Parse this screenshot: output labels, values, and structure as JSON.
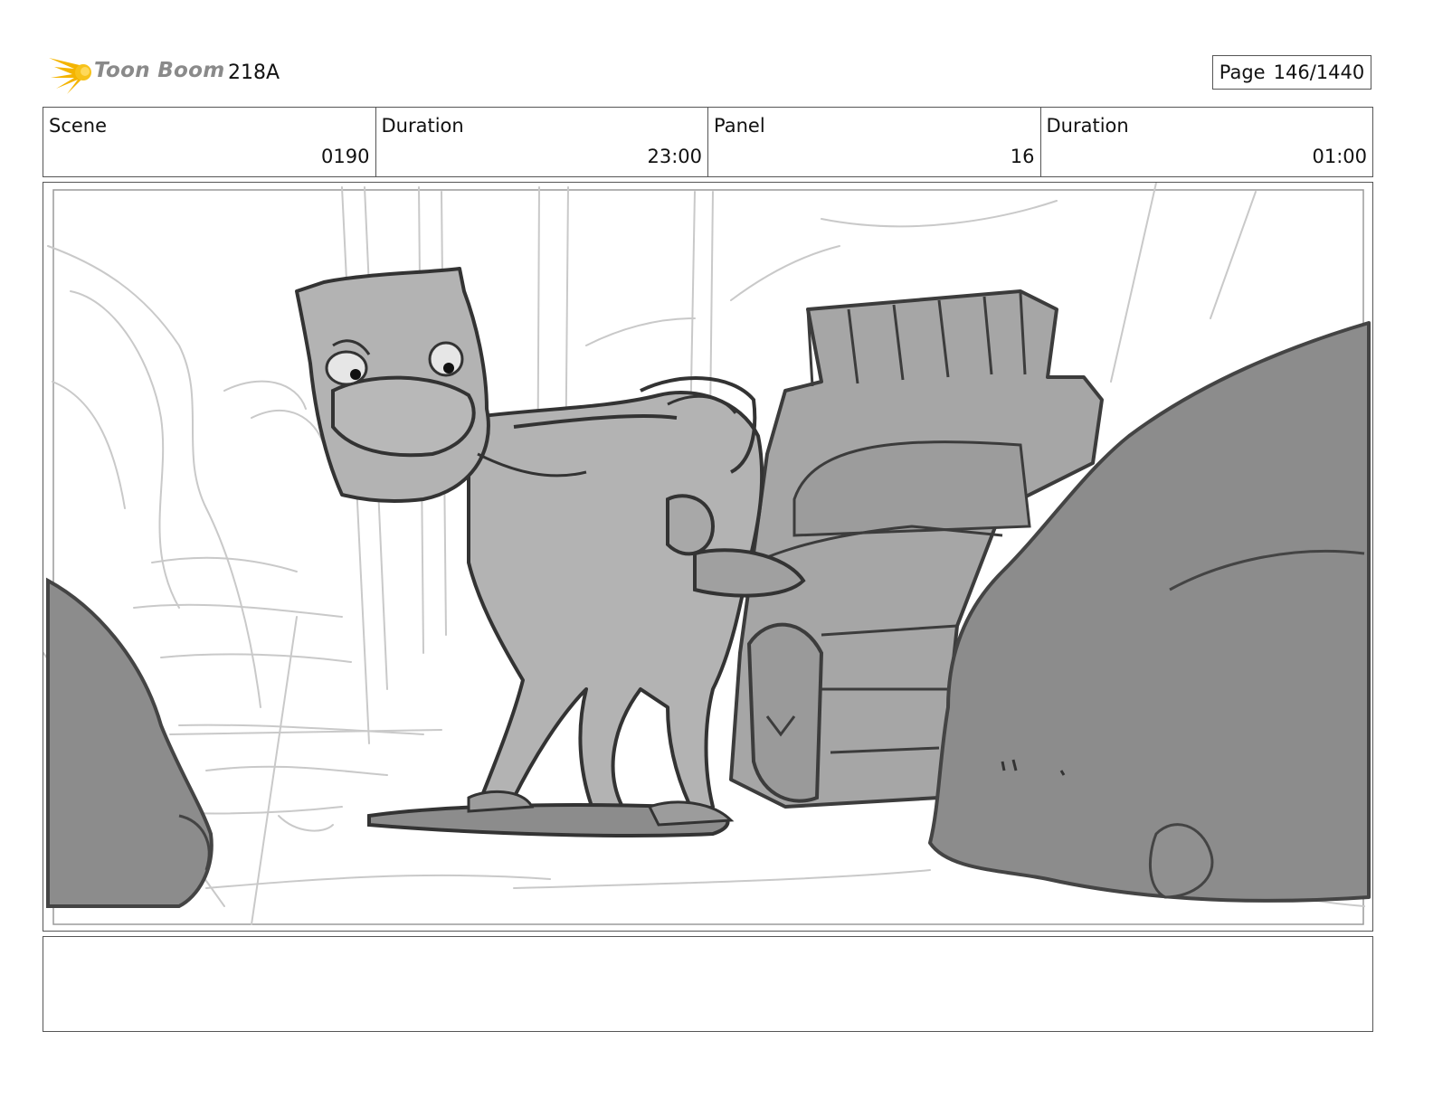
{
  "header": {
    "brand": "Toon Boom",
    "episode": "218A",
    "page_label": "Page",
    "page_number": "146/1440"
  },
  "info": {
    "scene_label": "Scene",
    "scene_value": "0190",
    "scene_duration_label": "Duration",
    "scene_duration_value": "23:00",
    "panel_label": "Panel",
    "panel_value": "16",
    "panel_duration_label": "Duration",
    "panel_duration_value": "01:00"
  },
  "panel": {
    "description": ""
  },
  "notes": {
    "text": ""
  }
}
